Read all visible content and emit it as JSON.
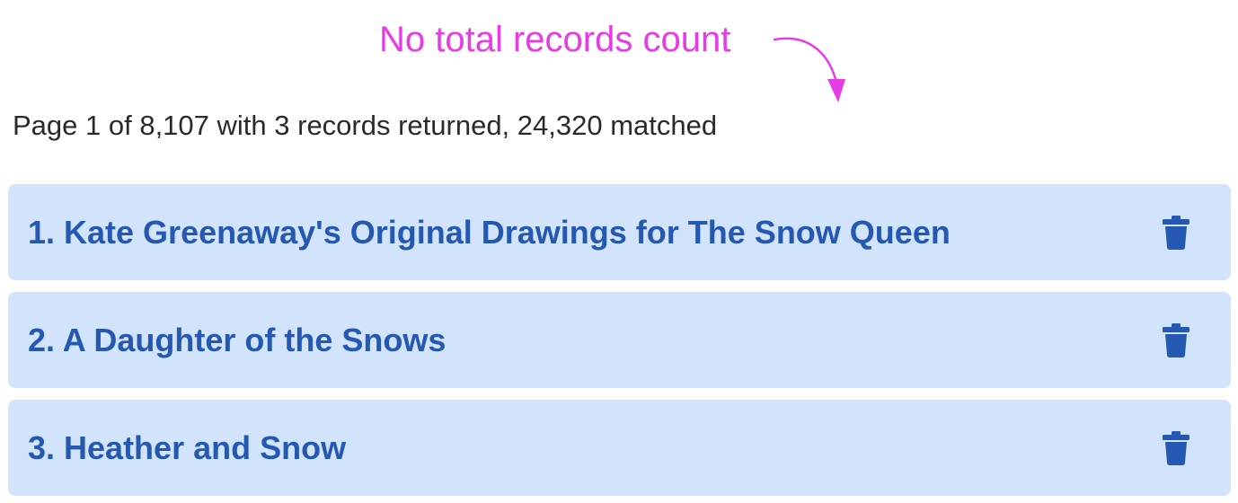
{
  "annotation": {
    "text": "No total records count",
    "color": "#e63ce6"
  },
  "summary": {
    "text": "Page 1 of 8,107 with 3 records returned, 24,320 matched"
  },
  "results": [
    {
      "label": "1. Kate Greenaway's Original Drawings for The Snow Queen",
      "action_icon": "trash-icon"
    },
    {
      "label": "2. A Daughter of the Snows",
      "action_icon": "trash-icon"
    },
    {
      "label": "3. Heather and Snow",
      "action_icon": "trash-icon"
    }
  ],
  "colors": {
    "row_background": "#d2e4fb",
    "row_text": "#2458b1",
    "summary_text": "#2a2a2a"
  }
}
